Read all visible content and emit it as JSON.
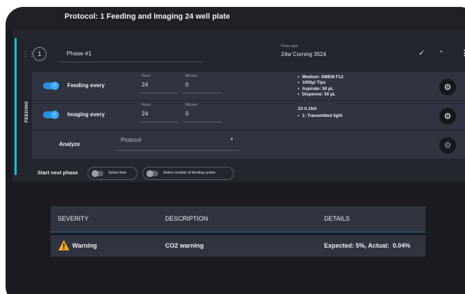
{
  "header": {
    "protocol_title": "Protocol: 1 Feeding and Imaging 24 well plate"
  },
  "phase": {
    "number": "1",
    "name": "Phase #1",
    "plate_type_label": "Plate type",
    "plate_type_value": "24w Corning 3524",
    "side_label": "FEEDING",
    "icons": {
      "handle": "drag-handle-icon",
      "confirm": "check-icon",
      "collapse": "chevron-up-icon",
      "menu": "more-vertical-icon"
    }
  },
  "feeding": {
    "enabled": true,
    "label": "Feeding every",
    "hours_label": "Hours",
    "hours_value": "24",
    "minutes_label": "Minutes",
    "minutes_value": "0",
    "details": [
      "Medium: DMEM F12",
      "1000µl Tips",
      "Aspirate: 50 µL",
      "Dispense: 50 µL"
    ]
  },
  "imaging": {
    "enabled": true,
    "label": "Imaging every",
    "hours_label": "Hours",
    "hours_value": "24",
    "minutes_label": "Minutes",
    "minutes_value": "0",
    "details_heading": "2X-0.1NA",
    "details": [
      "1: Transmitted light"
    ]
  },
  "analyze": {
    "label": "Analyze",
    "select_value": "Protocol"
  },
  "next_phase": {
    "label": "Start next phase",
    "option_time": "Select time",
    "option_cycles": "Select number of feeding cycles"
  },
  "warnings_table": {
    "columns": [
      "SEVERITY",
      "DESCRIPTION",
      "DETAILS"
    ],
    "rows": [
      {
        "severity": "Warning",
        "description": "CO2 warning",
        "details": "Expected: 5%, Actual:  0.04%"
      }
    ]
  },
  "colors": {
    "accent": "#19c3d8",
    "toggle_on": "#2a8fe0",
    "warning": "#f5a623",
    "background": "#1a1c21"
  }
}
